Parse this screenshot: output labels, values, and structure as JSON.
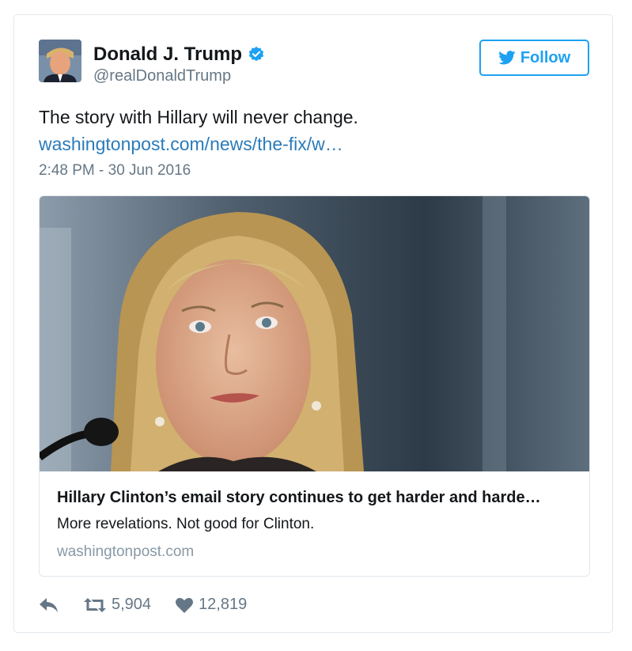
{
  "tweet": {
    "name": "Donald J. Trump",
    "handle": "@realDonaldTrump",
    "follow_label": "Follow",
    "text": "The story with Hillary will never change.",
    "link": "washingtonpost.com/news/the-fix/w…",
    "timestamp": "2:48 PM - 30 Jun 2016"
  },
  "card": {
    "title": "Hillary Clinton’s email story continues to get harder and harde…",
    "description": "More revelations. Not good for Clinton.",
    "domain": "washingtonpost.com"
  },
  "actions": {
    "retweets": "5,904",
    "likes": "12,819"
  },
  "icons": [
    "verified-icon",
    "twitter-bird-icon",
    "reply-icon",
    "retweet-icon",
    "heart-icon"
  ],
  "colors": {
    "accent": "#1da1f2",
    "link": "#2b7bb9",
    "muted": "#657786",
    "border": "#e1e8ed"
  }
}
